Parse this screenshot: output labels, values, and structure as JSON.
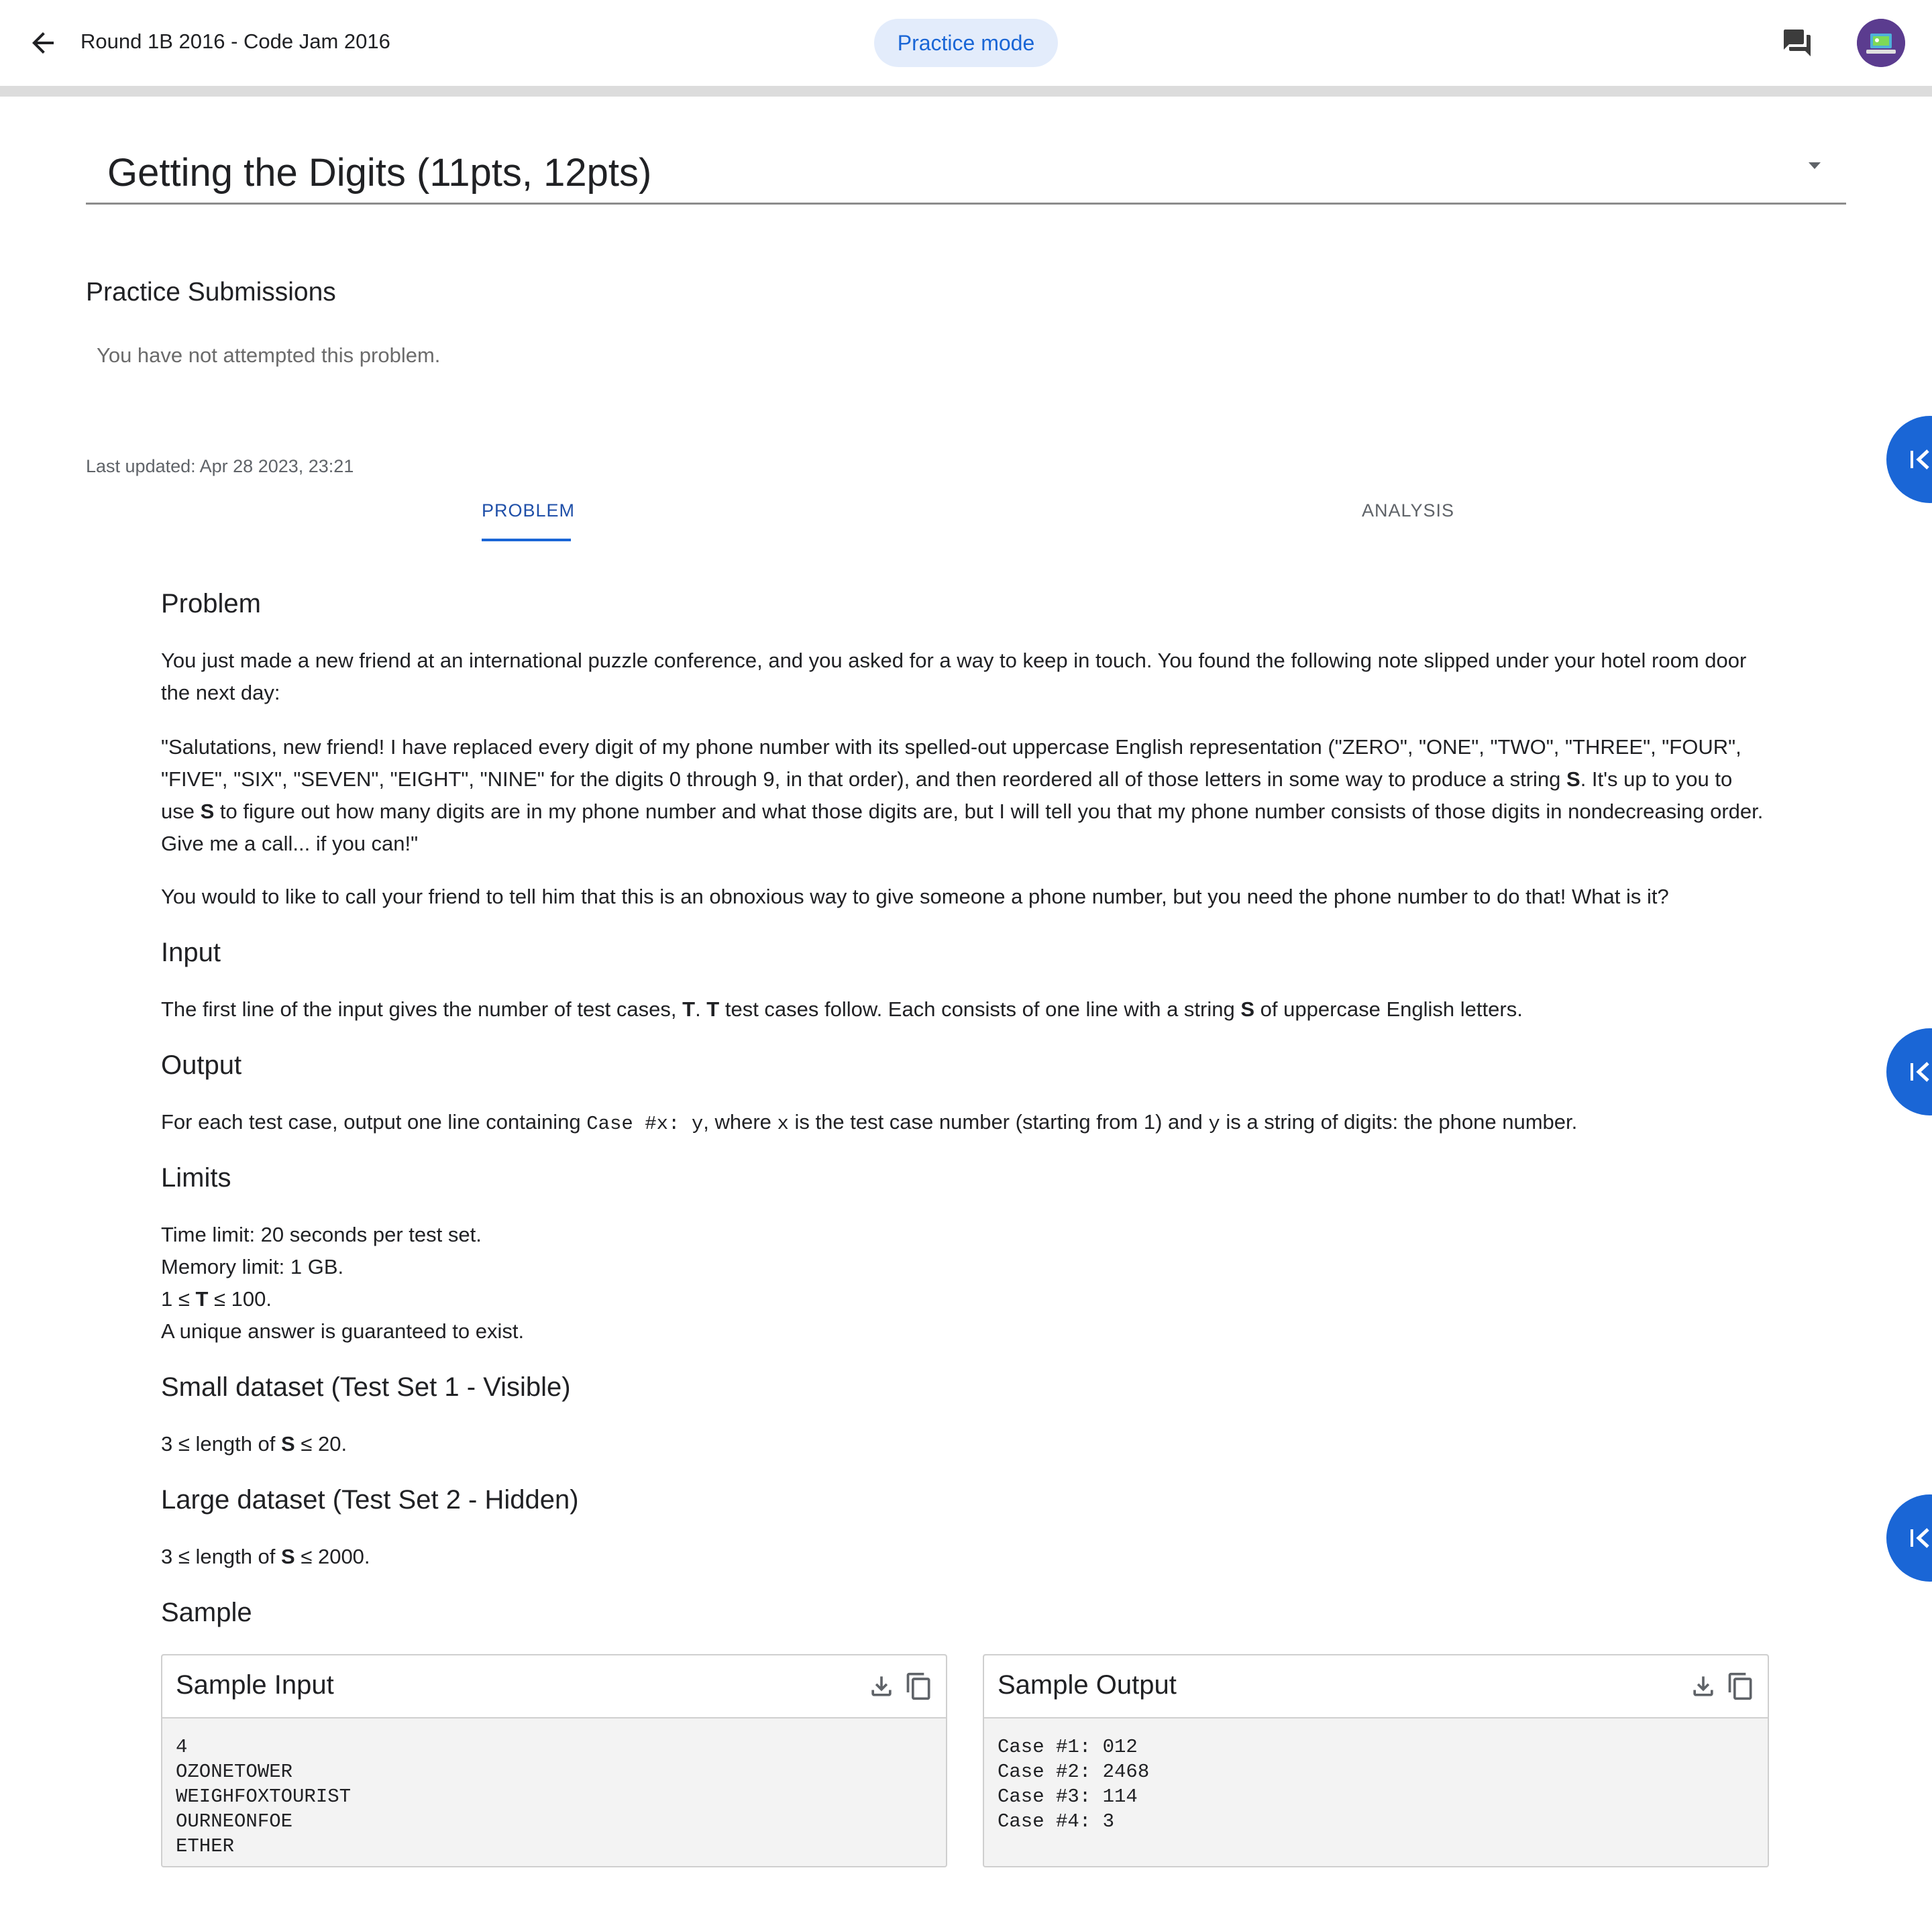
{
  "header": {
    "title": "Round 1B 2016 - Code Jam 2016",
    "practice_label": "Practice mode",
    "icons": {
      "back": "arrow-back-icon",
      "chat": "forum-icon"
    }
  },
  "problem_selector": {
    "title": "Getting the Digits (11pts, 12pts)"
  },
  "submissions": {
    "heading": "Practice Submissions",
    "empty_text": "You have not attempted this problem."
  },
  "last_updated": "Last updated: Apr 28 2023, 23:21",
  "tabs": [
    {
      "label": "PROBLEM",
      "active": true
    },
    {
      "label": "ANALYSIS",
      "active": false
    }
  ],
  "statement": {
    "problem_heading": "Problem",
    "p1": "You just made a new friend at an international puzzle conference, and you asked for a way to keep in touch. You found the following note slipped under your hotel room door the next day:",
    "p2a": "\"Salutations, new friend! I have replaced every digit of my phone number with its spelled-out uppercase English representation (\"ZERO\", \"ONE\", \"TWO\", \"THREE\", \"FOUR\", \"FIVE\", \"SIX\", \"SEVEN\", \"EIGHT\", \"NINE\" for the digits 0 through 9, in that order), and then reordered all of those letters in some way to produce a string ",
    "p2b": "S",
    "p2c": ". It's up to you to use ",
    "p2d": "S",
    "p2e": " to figure out how many digits are in my phone number and what those digits are, but I will tell you that my phone number consists of those digits in nondecreasing order. Give me a call... if you can!\"",
    "p3": "You would to like to call your friend to tell him that this is an obnoxious way to give someone a phone number, but you need the phone number to do that! What is it?",
    "input_heading": "Input",
    "input_a": "The first line of the input gives the number of test cases, ",
    "input_b": "T",
    "input_c": ". ",
    "input_d": "T",
    "input_e": " test cases follow. Each consists of one line with a string ",
    "input_f": "S",
    "input_g": " of uppercase English letters.",
    "output_heading": "Output",
    "output_a": "For each test case, output one line containing ",
    "output_code1": "Case #x: y",
    "output_b": ", where ",
    "output_code2": "x",
    "output_c": " is the test case number (starting from 1) and ",
    "output_code3": "y",
    "output_d": " is a string of digits: the phone number.",
    "limits_heading": "Limits",
    "limit_time": "Time limit: 20 seconds per test set.",
    "limit_memory": "Memory limit: 1 GB.",
    "limit_t_a": "1 ≤ ",
    "limit_t_b": "T",
    "limit_t_c": " ≤ 100.",
    "limit_unique": "A unique answer is guaranteed to exist.",
    "small_heading": "Small dataset (Test Set 1 - Visible)",
    "small_a": "3 ≤ length of ",
    "small_b": "S",
    "small_c": " ≤ 20.",
    "large_heading": "Large dataset (Test Set 2 - Hidden)",
    "large_a": "3 ≤ length of ",
    "large_b": "S",
    "large_c": " ≤ 2000.",
    "sample_heading": "Sample"
  },
  "sample_input": {
    "title": "Sample Input",
    "content": "4\nOZONETOWER\nWEIGHFOXTOURIST\nOURNEONFOE\nETHER"
  },
  "sample_output": {
    "title": "Sample Output",
    "content": "Case #1: 012\nCase #2: 2468\nCase #3: 114\nCase #4: 3"
  },
  "colors": {
    "accent": "#1a66d6",
    "pill_bg": "#e3ecfb",
    "text": "#202124",
    "muted": "#6b6b6b"
  }
}
